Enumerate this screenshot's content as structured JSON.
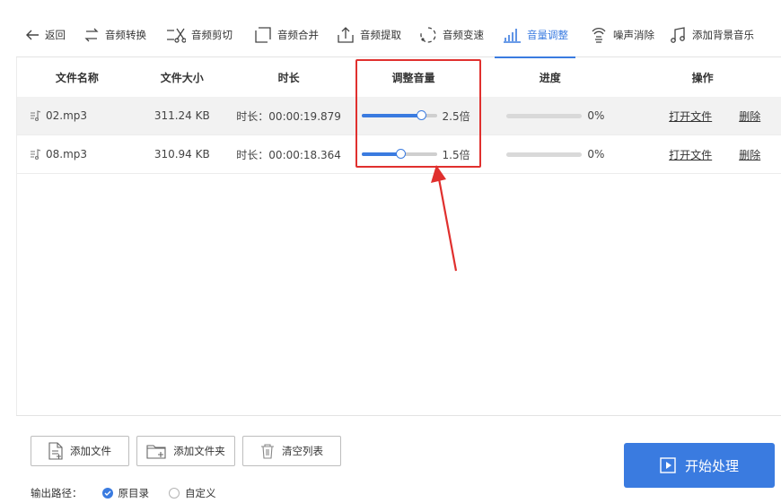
{
  "toolbar": {
    "items": [
      {
        "label": "返回",
        "icon": "back-arrow-icon"
      },
      {
        "label": "音频转换",
        "icon": "convert-arrows-icon"
      },
      {
        "label": "音频剪切",
        "icon": "scissors-icon"
      },
      {
        "label": "音频合并",
        "icon": "merge-square-icon"
      },
      {
        "label": "音频提取",
        "icon": "upload-extract-icon"
      },
      {
        "label": "音频变速",
        "icon": "speed-circle-icon"
      },
      {
        "label": "音量调整",
        "icon": "volume-bars-icon",
        "active": true
      },
      {
        "label": "噪声消除",
        "icon": "noise-cancel-icon"
      },
      {
        "label": "添加背景音乐",
        "icon": "music-note-icon"
      }
    ]
  },
  "table": {
    "headers": [
      "文件名称",
      "文件大小",
      "时长",
      "调整音量",
      "进度",
      "操作"
    ],
    "rows": [
      {
        "name": "02.mp3",
        "size": "311.24 KB",
        "duration": "时长：00:00:19.879",
        "volume_text": "2.5倍",
        "volume_level": 0.8,
        "progress": "0%",
        "progress_value": 0,
        "open": "打开文件",
        "delete": "删除",
        "selected": true
      },
      {
        "name": "08.mp3",
        "size": "310.94 KB",
        "duration": "时长：00:00:18.364",
        "volume_text": "1.5倍",
        "volume_level": 0.52,
        "progress": "0%",
        "progress_value": 0,
        "open": "打开文件",
        "delete": "删除",
        "selected": false
      }
    ]
  },
  "bottom": {
    "add_file": "添加文件",
    "add_folder": "添加文件夹",
    "clear_list": "清空列表",
    "output_label": "输出路径：",
    "option_original": "原目录",
    "option_custom": "自定义",
    "start": "开始处理"
  },
  "colors": {
    "accent": "#3a7be0",
    "highlight": "#e0302e"
  }
}
